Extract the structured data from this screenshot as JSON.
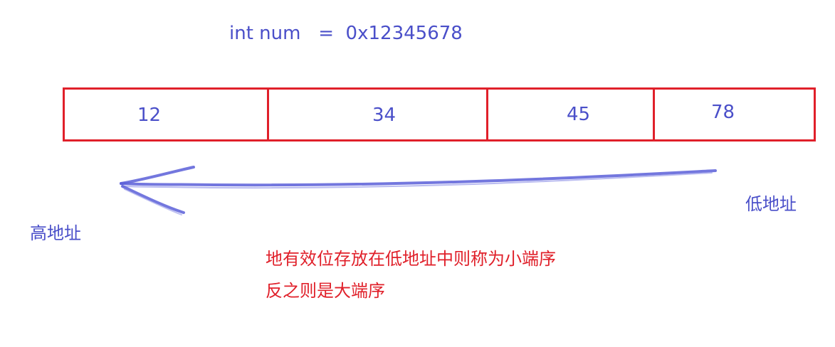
{
  "declaration": {
    "text": "int num   =  0x12345678"
  },
  "memory": {
    "cells": [
      "12",
      "34",
      "45",
      "78"
    ]
  },
  "labels": {
    "high_address": "高地址",
    "low_address": "低地址"
  },
  "notes": {
    "line1": "地有效位存放在低地址中则称为小端序",
    "line2": "反之则是大端序"
  },
  "colors": {
    "text_blue": "#4a4fc9",
    "box_red": "#e0202a",
    "arrow_blue": "#5a5fd8"
  }
}
